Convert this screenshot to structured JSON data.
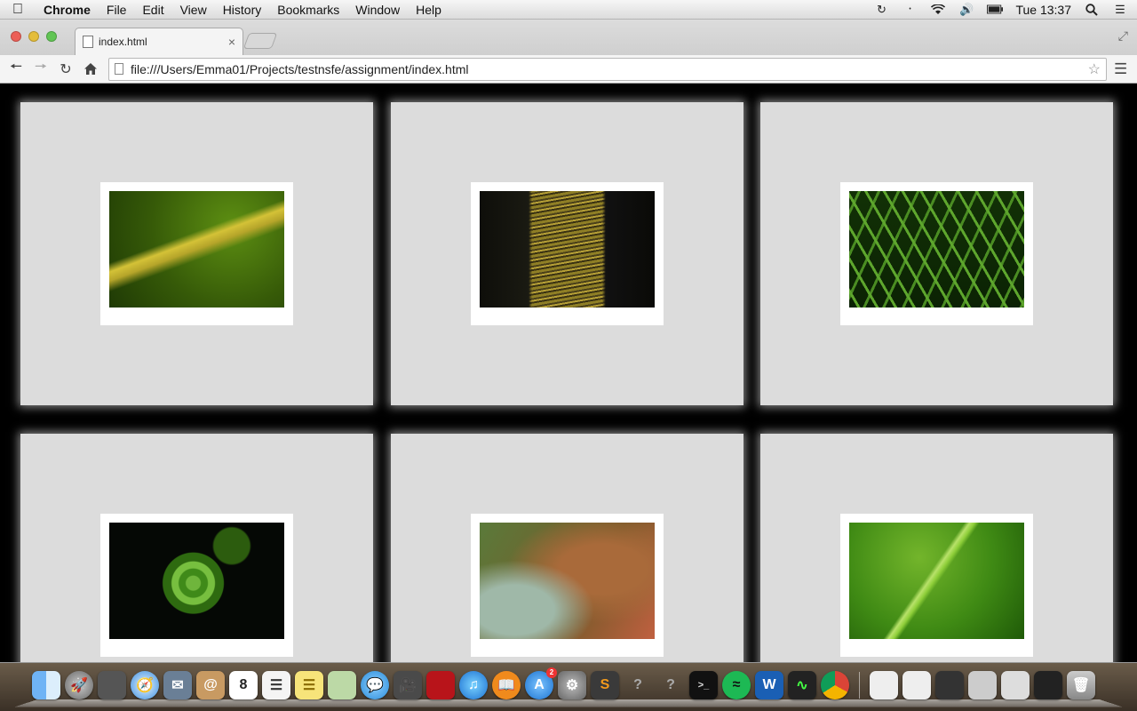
{
  "menubar": {
    "app_name": "Chrome",
    "menus": [
      "File",
      "Edit",
      "View",
      "History",
      "Bookmarks",
      "Window",
      "Help"
    ],
    "clock": "Tue 13:37"
  },
  "tab": {
    "title": "index.html",
    "close_glyph": "×"
  },
  "toolbar": {
    "url": "file:///Users/Emma01/Projects/testnsfe/assignment/index.html"
  },
  "gallery": {
    "photos": [
      "leaf-photo",
      "bark-photo",
      "fern-photo",
      "fiddlehead-photo",
      "succulent-photo",
      "large-leaf-photo"
    ]
  },
  "dock": {
    "apps": [
      "finder",
      "launchpad",
      "image-capture",
      "safari",
      "mail",
      "contacts",
      "calendar",
      "reminders",
      "notes",
      "maps",
      "messages",
      "facetime",
      "photo-booth",
      "itunes",
      "ibooks",
      "app-store",
      "system-preferences",
      "sublime-text",
      "unknown",
      "unknown",
      "terminal",
      "spotify",
      "word",
      "activity-monitor",
      "chrome"
    ],
    "calendar_day": "8",
    "app_store_badge": "2"
  }
}
